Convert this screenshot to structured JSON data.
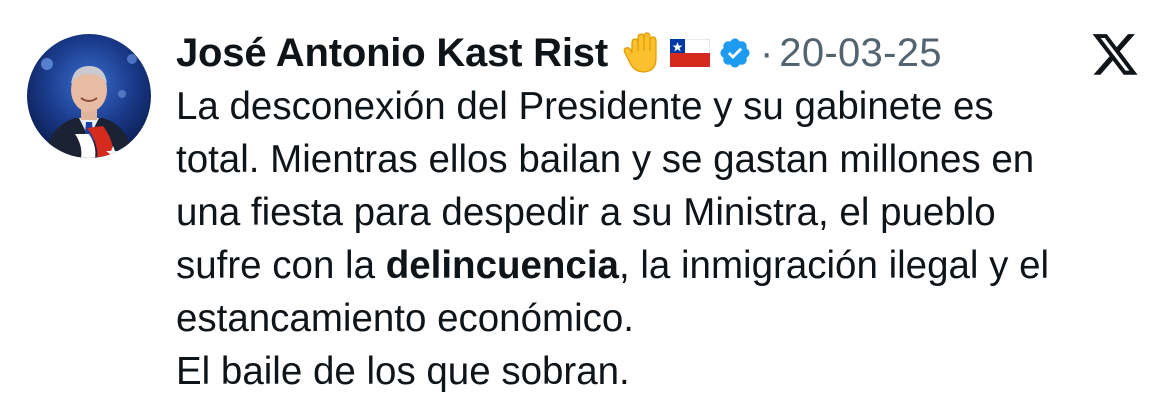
{
  "tweet": {
    "author_name": "José Antonio Kast Rist",
    "icons": [
      "raised-hand-emoji",
      "chile-flag-emoji",
      "verified-badge-icon",
      "x-logo-icon"
    ],
    "separator": "·",
    "timestamp": "20-03-25",
    "body": {
      "line1": "La desconexión del Presidente y su gabinete es",
      "line2": "total. Mientras ellos bailan y se gastan millones en",
      "line3": "una fiesta para despedir a su Ministra, el pueblo",
      "line4_before": "sufre con la ",
      "line4_bold": "delincuencia",
      "line4_after": ", la inmigración ilegal y el",
      "line5": "estancamiento económico.",
      "line6": "El baile de los que sobran."
    }
  },
  "colors": {
    "text_primary": "#0f1419",
    "text_secondary": "#536471",
    "verified_blue": "#1d9bf0",
    "flag_red": "#d52b1e",
    "flag_blue": "#0039a6"
  }
}
